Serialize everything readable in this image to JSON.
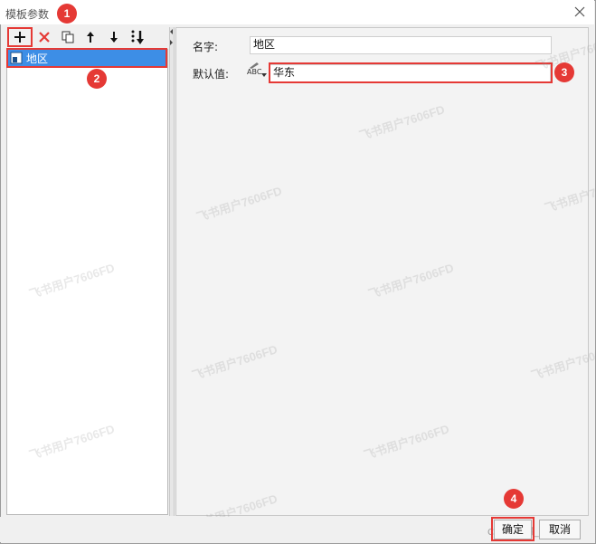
{
  "window": {
    "title": "模板参数"
  },
  "markers": [
    "1",
    "2",
    "3",
    "4"
  ],
  "toolbar": {
    "buttons": [
      {
        "name": "add",
        "icon": "plus-icon"
      },
      {
        "name": "delete",
        "icon": "x-icon"
      },
      {
        "name": "copy",
        "icon": "copy-icon"
      },
      {
        "name": "move-up",
        "icon": "arrow-up-icon"
      },
      {
        "name": "move-down",
        "icon": "arrow-down-icon"
      },
      {
        "name": "sort",
        "icon": "sort-icon"
      }
    ]
  },
  "tree": {
    "items": [
      {
        "label": "地区",
        "selected": true
      }
    ]
  },
  "form": {
    "name_label": "名字:",
    "name_value": "地区",
    "default_label": "默认值:",
    "default_value": "华东",
    "type_icon_text": "ABC"
  },
  "buttons": {
    "ok": "确定",
    "cancel": "取消"
  },
  "watermark": "飞书用户7606FD",
  "footer_text": "CSDN @帆_w",
  "colors": {
    "accent": "#3d8ee6",
    "highlight": "#e53935"
  }
}
